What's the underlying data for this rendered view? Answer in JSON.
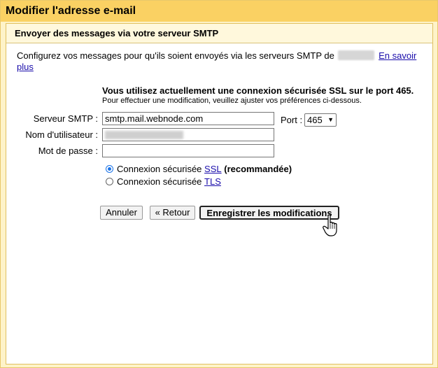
{
  "dialog": {
    "title": "Modifier l'adresse e-mail",
    "section_title": "Envoyer des messages via votre serveur SMTP",
    "description": "Configurez vos messages pour qu'ils soient envoyés via les serveurs SMTP de",
    "learn_more": "En savoir plus"
  },
  "notice": {
    "headline": "Vous utilisez actuellement une connexion sécurisée SSL sur le port 465.",
    "sub": "Pour effectuer une modification, veuillez ajuster vos préférences ci-dessous."
  },
  "form": {
    "smtp_label": "Serveur SMTP :",
    "smtp_value": "smtp.mail.webnode.com",
    "port_label": "Port :",
    "port_value": "465",
    "username_label": "Nom d'utilisateur :",
    "password_label": "Mot de passe :",
    "ssl_prefix": "Connexion sécurisée",
    "ssl_link": "SSL",
    "ssl_suffix": "(recommandée)",
    "tls_prefix": "Connexion sécurisée",
    "tls_link": "TLS",
    "ssl_checked": true
  },
  "buttons": {
    "cancel": "Annuler",
    "back": "« Retour",
    "save": "Enregistrer les modifications"
  },
  "colors": {
    "titlebar": "#fad163",
    "background": "#fef3c9",
    "link": "#1a0dab"
  },
  "icons": {
    "cursor": "hand-pointer-icon"
  }
}
